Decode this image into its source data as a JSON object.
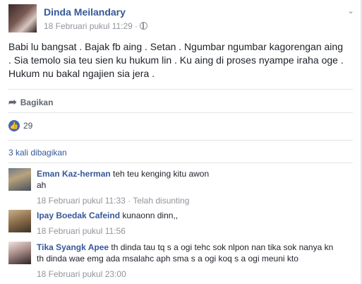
{
  "post": {
    "author": "Dinda Meilandary",
    "timestamp": "18 Februari pukul 11:29",
    "separator": "·",
    "privacy_icon": "globe-icon",
    "menu_icon": "chevron-down-icon",
    "text_lines": [
      "Babi lu bangsat . Bajak fb aing . Setan . Ngumbar ngumbar kagorengan aing",
      ". Sia temolo sia teu sien ku hukum lin . Ku aing di proses nyampe iraha oge .",
      "Hukum nu bakal ngajien sia jera ."
    ],
    "share_label": "Bagikan",
    "like_count": "29",
    "shares_text": "3 kali dibagikan"
  },
  "comments": [
    {
      "name": "Eman Kaz-herman",
      "text_line1": "teh teu kenging kitu awon",
      "text_line2": "ah",
      "time": "18 Februari pukul 11:33",
      "separator": "·",
      "extra": "Telah disunting"
    },
    {
      "name": "Ipay Boedak Cafeind",
      "text_line1": "kunaonn dinn,,",
      "time": "18 Februari pukul 11:56"
    },
    {
      "name": "Tika Syangk Apee",
      "text_line1": "th dinda tau tq s a ogi tehc sok nlpon nan tika sok nanya kn",
      "text_line2": "th dinda wae emg ada msalahc aph sma s a ogi koq s a ogi meuni kto",
      "time": "18 Februari pukul 23:00"
    }
  ],
  "colors": {
    "link_blue": "#365899",
    "like_blue": "#4267b2",
    "muted": "#90949c"
  }
}
